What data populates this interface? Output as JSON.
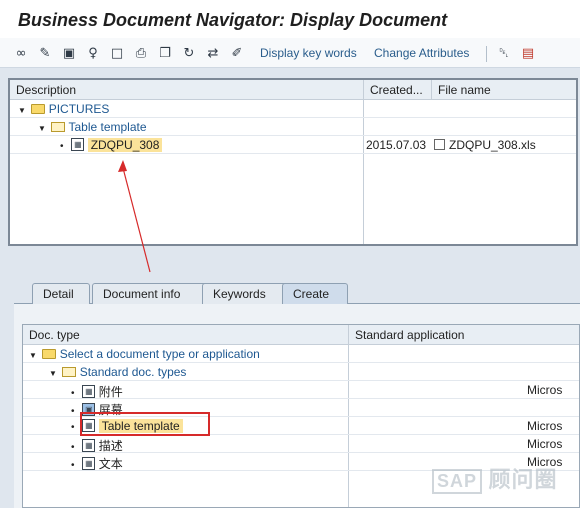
{
  "window": {
    "title": "Business Document Navigator: Display Document"
  },
  "toolbar": {
    "icons": [
      "glasses-icon",
      "pencil-icon",
      "display-icon",
      "person-icon",
      "new-doc-icon",
      "print-icon",
      "copy-icon",
      "refresh-icon",
      "transfer-icon",
      "highlighter-icon"
    ],
    "key_words_label": "Display key words",
    "change_attributes_label": "Change Attributes",
    "delete_icon": "trash-icon",
    "transport_icon": "truck-icon"
  },
  "top_grid": {
    "columns": [
      "Description",
      "Created...",
      "File name"
    ],
    "rows": [
      {
        "label": "PICTURES",
        "created": "",
        "file": ""
      },
      {
        "label": "Table template",
        "created": "",
        "file": ""
      },
      {
        "label": "ZDQPU_308",
        "created": "2015.07.03",
        "file": "ZDQPU_308.xls"
      }
    ]
  },
  "tabs": [
    "Detail",
    "Document info",
    "Keywords",
    "Create"
  ],
  "active_tab": "Create",
  "bottom_grid": {
    "columns": [
      "Doc. type",
      "Standard application"
    ],
    "rows": [
      {
        "label": "Select a document type or application",
        "app": ""
      },
      {
        "label": "Standard doc. types",
        "app": ""
      },
      {
        "label": "附件",
        "app": "Micros"
      },
      {
        "label": "屏幕",
        "app": ""
      },
      {
        "label": "Table template",
        "app": "Micros"
      },
      {
        "label": "描述",
        "app": "Micros"
      },
      {
        "label": "文本",
        "app": "Micros"
      }
    ]
  },
  "watermark": {
    "brand": "SAP",
    "text": "顾问圈"
  },
  "colors": {
    "highlight": "#fbe39a",
    "annotation_red": "#d62a2a",
    "link_blue": "#1e5891"
  }
}
